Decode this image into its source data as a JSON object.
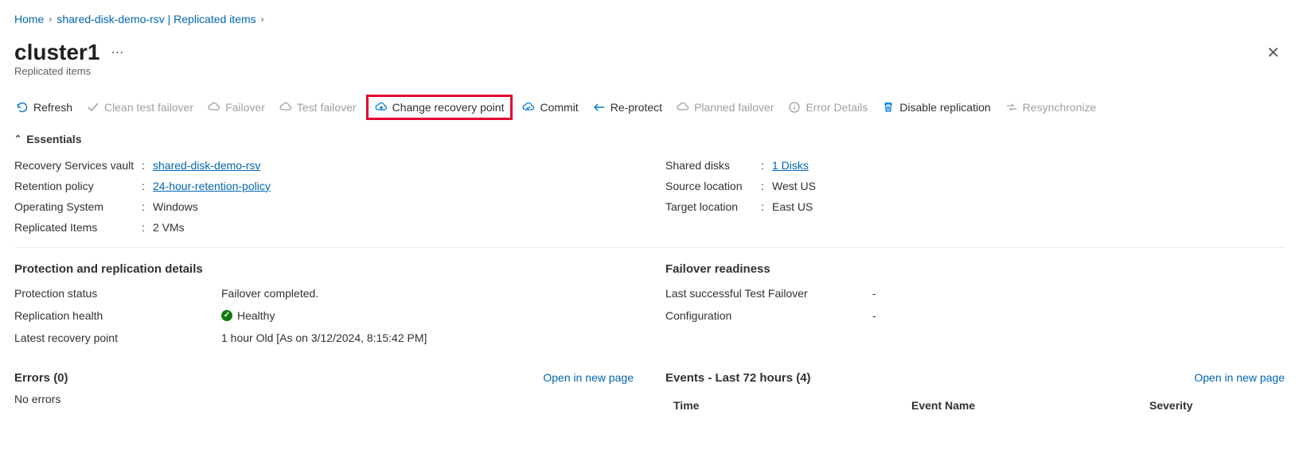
{
  "breadcrumb": {
    "home": "Home",
    "vault": "shared-disk-demo-rsv | Replicated items"
  },
  "page": {
    "title": "cluster1",
    "subtitle": "Replicated items"
  },
  "toolbar": {
    "refresh": "Refresh",
    "clean_test_failover": "Clean test failover",
    "failover": "Failover",
    "test_failover": "Test failover",
    "change_recovery_point": "Change recovery point",
    "commit": "Commit",
    "reprotect": "Re-protect",
    "planned_failover": "Planned failover",
    "error_details": "Error Details",
    "disable_replication": "Disable replication",
    "resynchronize": "Resynchronize"
  },
  "essentials": {
    "header": "Essentials",
    "left": {
      "recovery_services_vault_label": "Recovery Services vault",
      "recovery_services_vault_value": "shared-disk-demo-rsv",
      "retention_policy_label": "Retention policy",
      "retention_policy_value": "24-hour-retention-policy",
      "operating_system_label": "Operating System",
      "operating_system_value": "Windows",
      "replicated_items_label": "Replicated Items",
      "replicated_items_value": "2 VMs"
    },
    "right": {
      "shared_disks_label": "Shared disks",
      "shared_disks_value": "1 Disks",
      "source_location_label": "Source location",
      "source_location_value": "West US",
      "target_location_label": "Target location",
      "target_location_value": "East US"
    }
  },
  "protection": {
    "title": "Protection and replication details",
    "protection_status_label": "Protection status",
    "protection_status_value": "Failover completed.",
    "replication_health_label": "Replication health",
    "replication_health_value": "Healthy",
    "latest_recovery_point_label": "Latest recovery point",
    "latest_recovery_point_value": "1 hour Old [As on 3/12/2024, 8:15:42 PM]"
  },
  "failover_readiness": {
    "title": "Failover readiness",
    "last_test_label": "Last successful Test Failover",
    "last_test_value": "-",
    "configuration_label": "Configuration",
    "configuration_value": "-"
  },
  "errors": {
    "title": "Errors (0)",
    "open_link": "Open in new page",
    "empty": "No errors"
  },
  "events": {
    "title": "Events - Last 72 hours (4)",
    "open_link": "Open in new page",
    "columns": {
      "time": "Time",
      "name": "Event Name",
      "severity": "Severity"
    }
  }
}
